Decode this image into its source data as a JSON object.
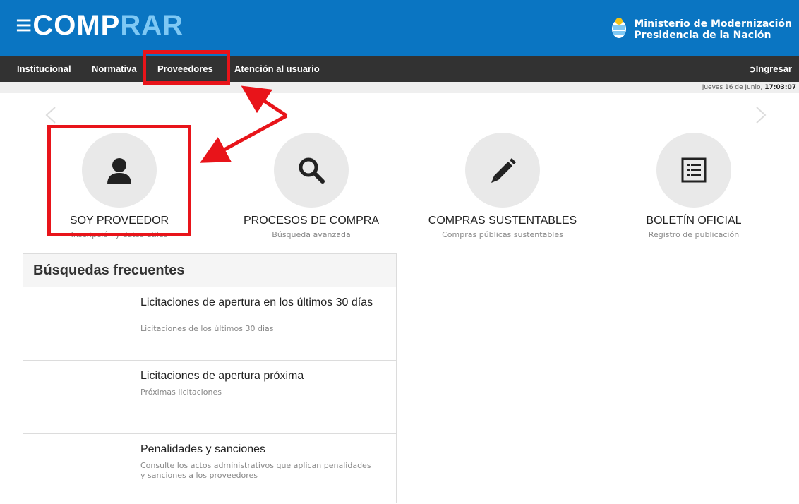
{
  "header": {
    "logo_part1": "≡COMP",
    "logo_part2": "RAR",
    "ministry_line1": "Ministerio de Modernización",
    "ministry_line2": "Presidencia de la Nación"
  },
  "nav": {
    "items": [
      {
        "label": "Institucional"
      },
      {
        "label": "Normativa"
      },
      {
        "label": "Proveedores"
      },
      {
        "label": "Atención al usuario"
      }
    ],
    "login_label": "Ingresar"
  },
  "dateline": {
    "date_text": "Jueves 16 de Junio, ",
    "time_text": "17:03:07"
  },
  "tiles": [
    {
      "title": "SOY PROVEEDOR",
      "subtitle": "Inscripción y datos utiles",
      "icon": "user-icon"
    },
    {
      "title": "PROCESOS DE COMPRA",
      "subtitle": "Búsqueda avanzada",
      "icon": "search-icon"
    },
    {
      "title": "COMPRAS SUSTENTABLES",
      "subtitle": "Compras públicas sustentables",
      "icon": "pencil-icon"
    },
    {
      "title": "BOLETÍN OFICIAL",
      "subtitle": "Registro de publicación",
      "icon": "list-document-icon"
    }
  ],
  "frequent": {
    "title": "Búsquedas frecuentes",
    "items": [
      {
        "title": "Licitaciones de apertura en los últimos 30 días",
        "subtitle": "Licitaciones de los últimos 30 dias"
      },
      {
        "title": "Licitaciones de apertura próxima",
        "subtitle": "Próximas licitaciones"
      },
      {
        "title": "Penalidades y sanciones",
        "subtitle": "Consulte los actos administrativos que aplican penalidades y sanciones a los proveedores"
      }
    ]
  },
  "colors": {
    "header_bg": "#0a75c2",
    "navbar_bg": "#323232",
    "annotation_red": "#e8141a"
  }
}
